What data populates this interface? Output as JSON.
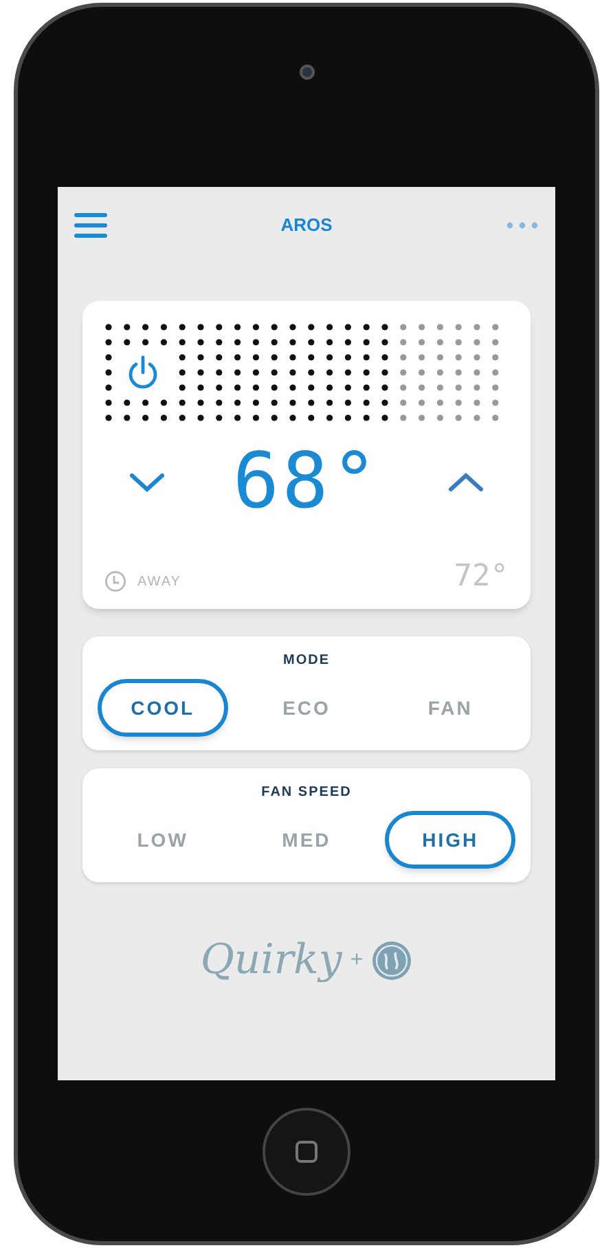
{
  "app_bar": {
    "title": "AROS"
  },
  "thermostat": {
    "set_temperature": "68°",
    "away_label": "AWAY",
    "room_temperature": "72°"
  },
  "mode": {
    "title": "MODE",
    "options": [
      {
        "label": "COOL",
        "selected": true
      },
      {
        "label": "ECO",
        "selected": false
      },
      {
        "label": "FAN",
        "selected": false
      }
    ]
  },
  "fan_speed": {
    "title": "FAN SPEED",
    "options": [
      {
        "label": "LOW",
        "selected": false
      },
      {
        "label": "MED",
        "selected": false
      },
      {
        "label": "HIGH",
        "selected": true
      }
    ]
  },
  "branding": {
    "name": "Quirky",
    "separator": "+"
  }
}
